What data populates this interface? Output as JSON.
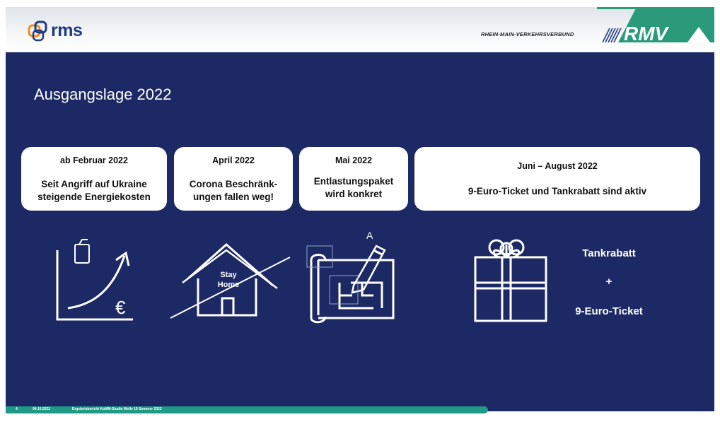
{
  "header": {
    "logo_text": "rms",
    "rmv_name": "RHEIN-MAIN-VERKEHRSVERBUND",
    "rmv_logo_text": "RMV"
  },
  "slide": {
    "title": "Ausgangslage 2022"
  },
  "cards": [
    {
      "date": "ab Februar 2022",
      "line1": "Seit Angriff auf Ukraine",
      "line2": "steigende Energiekosten"
    },
    {
      "date": "April 2022",
      "line1": "Corona Beschränk-",
      "line2": "ungen fallen weg!"
    },
    {
      "date": "Mai 2022",
      "line1": "Entlastungspaket",
      "line2": "wird konkret"
    },
    {
      "date": "Juni – August 2022",
      "line1": "9-Euro-Ticket und Tankrabatt sind aktiv"
    }
  ],
  "icons": {
    "energy": {
      "euro_symbol": "€"
    },
    "stay_home": {
      "line1": "Stay",
      "line2": "Home"
    },
    "blueprint": {
      "letter": "A"
    },
    "gift": {
      "item1": "Tankrabatt",
      "plus": "+",
      "item2": "9-Euro-Ticket"
    }
  },
  "footer": {
    "page_number": "4",
    "date": "04.10.2022",
    "description": "Ergebnisbericht KoMM-Studie Welle 19 Sommer 2022"
  },
  "colors": {
    "background": "#1c2964",
    "accent_teal": "#1f9a86",
    "rmv_green": "#2a9a7a",
    "rms_blue": "#203a86",
    "rms_orange": "#f08a1c"
  }
}
